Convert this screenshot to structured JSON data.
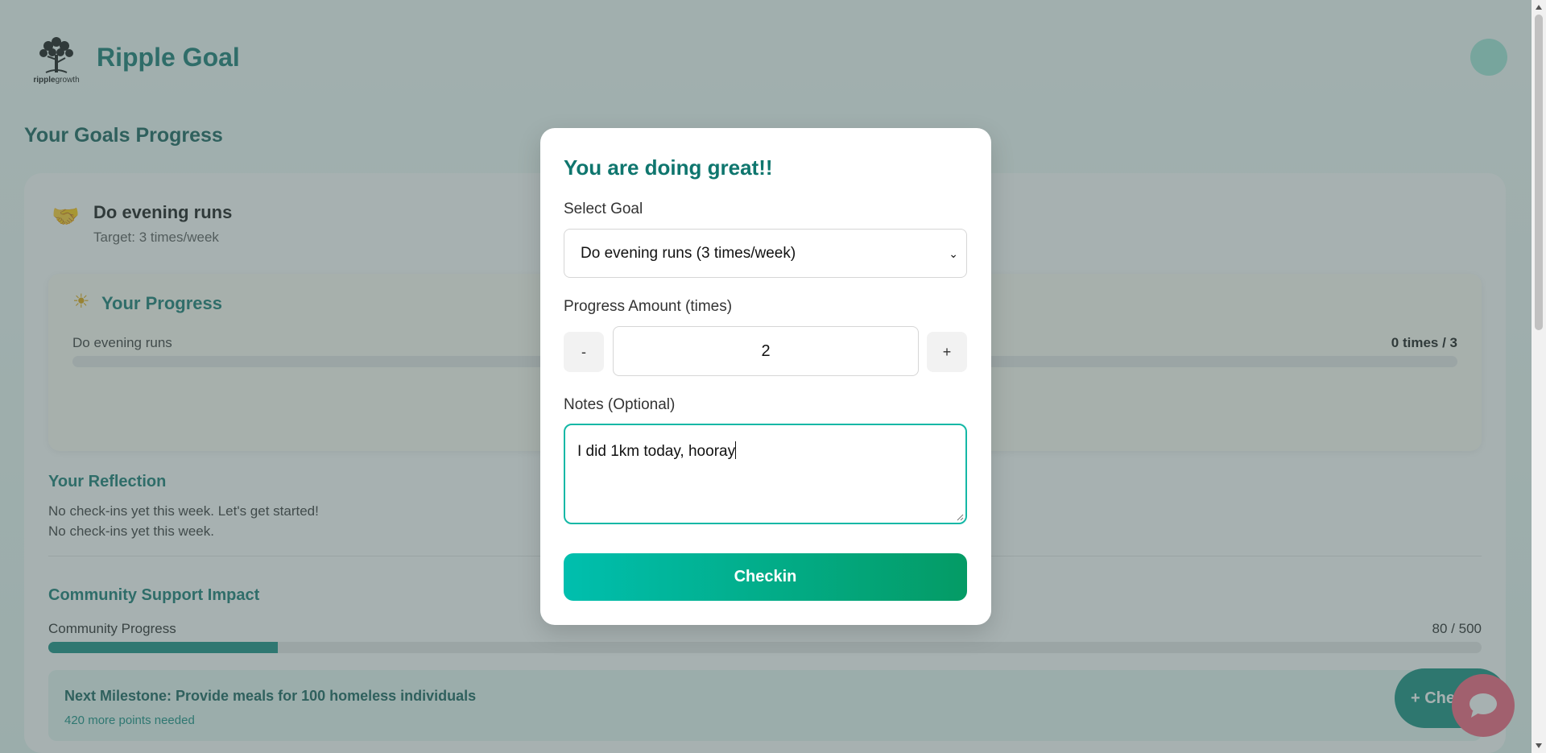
{
  "app": {
    "title": "Ripple Goal",
    "logo_text_bold": "ripple",
    "logo_text_rest": "growth"
  },
  "page": {
    "section_title": "Your Goals Progress"
  },
  "goal": {
    "emoji": "🤝",
    "name": "Do evening runs",
    "target": "Target: 3 times/week"
  },
  "progress": {
    "icon": "☀",
    "title": "Your Progress",
    "goal_label": "Do evening runs",
    "count_text": "0 times / 3",
    "fraction": 0
  },
  "reflection": {
    "title": "Your Reflection",
    "line1": "No check-ins yet this week. Let's get started!",
    "line2": "No check-ins yet this week."
  },
  "community": {
    "title": "Community Support Impact",
    "label": "Community Progress",
    "count_text": "80 / 500",
    "current": 80,
    "total": 500
  },
  "milestone": {
    "title": "Next Milestone: Provide meals for 100 homeless individuals",
    "subtitle": "420 more points needed"
  },
  "fab": {
    "checkin_label": "+ Checkin"
  },
  "modal": {
    "title": "You are doing great!!",
    "select_label": "Select Goal",
    "select_value": "Do evening runs (3 times/week)",
    "amount_label": "Progress Amount (times)",
    "decrement": "-",
    "increment": "+",
    "amount_value": "2",
    "notes_label": "Notes (Optional)",
    "notes_value": "I did 1km today, hooray",
    "submit_label": "Checkin"
  },
  "colors": {
    "accent": "#0f766e",
    "teal": "#14b8a6",
    "chat": "#f25c79"
  }
}
